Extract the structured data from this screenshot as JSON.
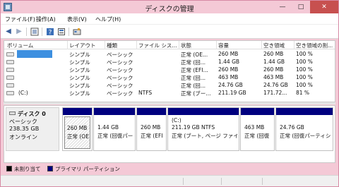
{
  "window": {
    "title": "ディスクの管理",
    "minimize": "—",
    "maximize": "□",
    "close": "✕"
  },
  "menu": [
    {
      "label": "ファイル(F)"
    },
    {
      "label": "操作(A)"
    },
    {
      "label": "表示(V)"
    },
    {
      "label": "ヘルプ(H)"
    }
  ],
  "toolbar": {
    "back": "◀",
    "forward": "▶"
  },
  "list": {
    "headers": [
      "ボリューム",
      "レイアウト",
      "種類",
      "ファイル シス...",
      "状態",
      "容量",
      "空き領域",
      "空き領域の割..."
    ],
    "rows": [
      {
        "volume": "",
        "layout": "シンプル",
        "type": "ベーシック",
        "fs": "",
        "status": "正常 (OE...",
        "capacity": "260 MB",
        "free": "260 MB",
        "pct": "100 %"
      },
      {
        "volume": "",
        "layout": "シンプル",
        "type": "ベーシック",
        "fs": "",
        "status": "正常 (回...",
        "capacity": "1.44 GB",
        "free": "1.44 GB",
        "pct": "100 %"
      },
      {
        "volume": "",
        "layout": "シンプル",
        "type": "ベーシック",
        "fs": "",
        "status": "正常 (EFI...",
        "capacity": "260 MB",
        "free": "260 MB",
        "pct": "100 %"
      },
      {
        "volume": "",
        "layout": "シンプル",
        "type": "ベーシック",
        "fs": "",
        "status": "正常 (回...",
        "capacity": "463 MB",
        "free": "463 MB",
        "pct": "100 %"
      },
      {
        "volume": "",
        "layout": "シンプル",
        "type": "ベーシック",
        "fs": "",
        "status": "正常 (回...",
        "capacity": "24.76 GB",
        "free": "24.76 GB",
        "pct": "100 %"
      },
      {
        "volume": "(C:)",
        "layout": "シンプル",
        "type": "ベーシック",
        "fs": "NTFS",
        "status": "正常 (ブー...",
        "capacity": "211.19 GB",
        "free": "171.72...",
        "pct": "81 %"
      }
    ]
  },
  "disk": {
    "name": "ディスク 0",
    "type": "ベーシック",
    "size": "238.35 GB",
    "state": "オンライン"
  },
  "partitions": [
    {
      "line1": "",
      "line2": "260 MB",
      "line3": "正常 (OE"
    },
    {
      "line1": "",
      "line2": "1.44 GB",
      "line3": "正常 (回復パー"
    },
    {
      "line1": "",
      "line2": "260 MB",
      "line3": "正常 (EFI"
    },
    {
      "line1": "(C:)",
      "line2": "211.19 GB NTFS",
      "line3": "正常 (ブート, ページ ファイル"
    },
    {
      "line1": "",
      "line2": "463 MB",
      "line3": "正常 (回復"
    },
    {
      "line1": "",
      "line2": "24.76 GB",
      "line3": "正常 (回復パーティショ"
    }
  ],
  "legend": {
    "unallocated": "未割り当て",
    "primary": "プライマリ パーティション"
  },
  "colors": {
    "titlebar": "#f4c9d6",
    "highlight": "#3d8fe0",
    "partition_bar": "#00007f",
    "close_button": "#c7504f"
  }
}
